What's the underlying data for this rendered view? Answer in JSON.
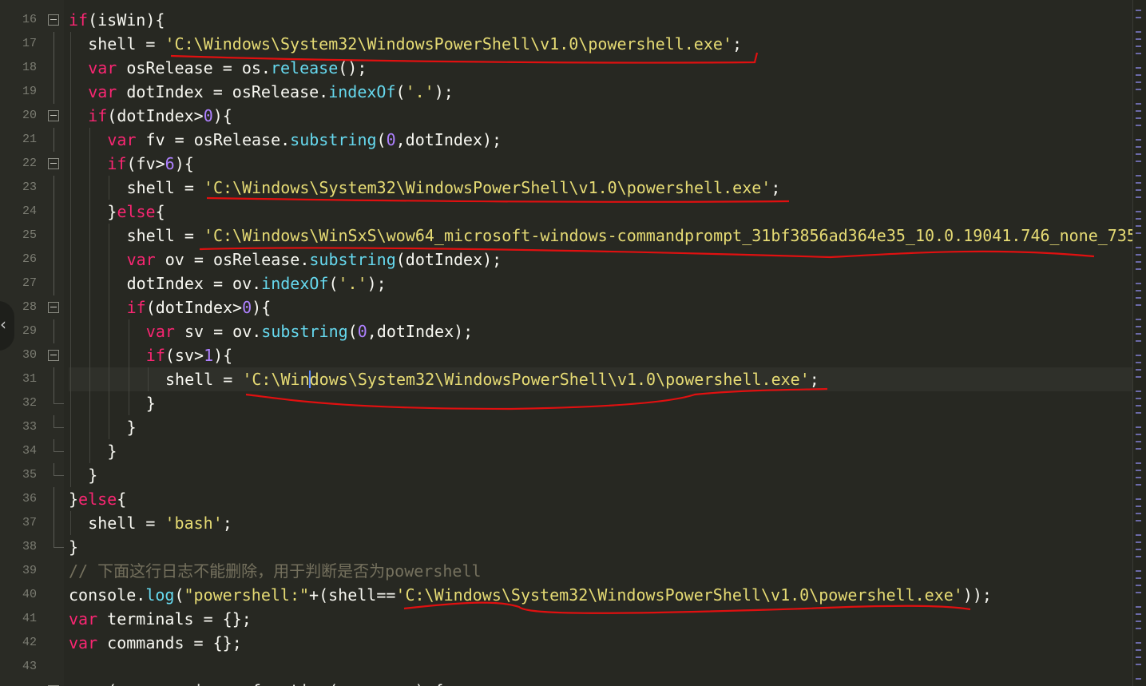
{
  "editor": {
    "lines": [
      {
        "num": "16",
        "indent": 0,
        "fold": "box",
        "tokens": [
          [
            "kw",
            "if"
          ],
          [
            "pl",
            "(isWin){"
          ]
        ]
      },
      {
        "num": "17",
        "indent": 1,
        "fold": "rail",
        "tokens": [
          [
            "pl",
            "shell = "
          ],
          [
            "str",
            "'C:\\Windows\\System32\\WindowsPowerShell\\v1.0\\powershell.exe'"
          ],
          [
            "pl",
            ";"
          ]
        ]
      },
      {
        "num": "18",
        "indent": 1,
        "fold": "rail",
        "tokens": [
          [
            "kw",
            "var"
          ],
          [
            "pl",
            " osRelease = os."
          ],
          [
            "fn",
            "release"
          ],
          [
            "pl",
            "();"
          ]
        ]
      },
      {
        "num": "19",
        "indent": 1,
        "fold": "rail",
        "tokens": [
          [
            "kw",
            "var"
          ],
          [
            "pl",
            " dotIndex = osRelease."
          ],
          [
            "fn",
            "indexOf"
          ],
          [
            "pl",
            "("
          ],
          [
            "str",
            "'.'"
          ],
          [
            "pl",
            ");"
          ]
        ]
      },
      {
        "num": "20",
        "indent": 1,
        "fold": "box",
        "tokens": [
          [
            "kw",
            "if"
          ],
          [
            "pl",
            "(dotIndex>"
          ],
          [
            "num",
            "0"
          ],
          [
            "pl",
            "){"
          ]
        ]
      },
      {
        "num": "21",
        "indent": 2,
        "fold": "rail",
        "tokens": [
          [
            "kw",
            "var"
          ],
          [
            "pl",
            " fv = osRelease."
          ],
          [
            "fn",
            "substring"
          ],
          [
            "pl",
            "("
          ],
          [
            "num",
            "0"
          ],
          [
            "pl",
            ",dotIndex);"
          ]
        ]
      },
      {
        "num": "22",
        "indent": 2,
        "fold": "box",
        "tokens": [
          [
            "kw",
            "if"
          ],
          [
            "pl",
            "(fv>"
          ],
          [
            "num",
            "6"
          ],
          [
            "pl",
            "){"
          ]
        ]
      },
      {
        "num": "23",
        "indent": 3,
        "fold": "rail",
        "tokens": [
          [
            "pl",
            "shell = "
          ],
          [
            "str",
            "'C:\\Windows\\System32\\WindowsPowerShell\\v1.0\\powershell.exe'"
          ],
          [
            "pl",
            ";"
          ]
        ]
      },
      {
        "num": "24",
        "indent": 2,
        "fold": "rail",
        "tokens": [
          [
            "pl",
            "}"
          ],
          [
            "kw",
            "else"
          ],
          [
            "pl",
            "{"
          ]
        ]
      },
      {
        "num": "25",
        "indent": 3,
        "fold": "rail",
        "tokens": [
          [
            "pl",
            "shell = "
          ],
          [
            "str",
            "'C:\\Windows\\WinSxS\\wow64_microsoft-windows-commandprompt_31bf3856ad364e35_10.0.19041.746_none_735"
          ]
        ]
      },
      {
        "num": "26",
        "indent": 3,
        "fold": "rail",
        "tokens": [
          [
            "kw",
            "var"
          ],
          [
            "pl",
            " ov = osRelease."
          ],
          [
            "fn",
            "substring"
          ],
          [
            "pl",
            "(dotIndex);"
          ]
        ]
      },
      {
        "num": "27",
        "indent": 3,
        "fold": "rail",
        "tokens": [
          [
            "pl",
            "dotIndex = ov."
          ],
          [
            "fn",
            "indexOf"
          ],
          [
            "pl",
            "("
          ],
          [
            "str",
            "'.'"
          ],
          [
            "pl",
            ");"
          ]
        ]
      },
      {
        "num": "28",
        "indent": 3,
        "fold": "box",
        "tokens": [
          [
            "kw",
            "if"
          ],
          [
            "pl",
            "(dotIndex>"
          ],
          [
            "num",
            "0"
          ],
          [
            "pl",
            "){"
          ]
        ]
      },
      {
        "num": "29",
        "indent": 4,
        "fold": "rail",
        "tokens": [
          [
            "kw",
            "var"
          ],
          [
            "pl",
            " sv = ov."
          ],
          [
            "fn",
            "substring"
          ],
          [
            "pl",
            "("
          ],
          [
            "num",
            "0"
          ],
          [
            "pl",
            ",dotIndex);"
          ]
        ]
      },
      {
        "num": "30",
        "indent": 4,
        "fold": "box",
        "tokens": [
          [
            "kw",
            "if"
          ],
          [
            "pl",
            "(sv>"
          ],
          [
            "num",
            "1"
          ],
          [
            "pl",
            "){"
          ]
        ]
      },
      {
        "num": "31",
        "indent": 5,
        "fold": "rail",
        "current": true,
        "tokens": [
          [
            "pl",
            "shell = "
          ],
          [
            "str",
            "'C:\\Win"
          ],
          [
            "cursor",
            ""
          ],
          [
            "str",
            "dows\\System32\\WindowsPowerShell\\v1.0\\powershell.exe'"
          ],
          [
            "pl",
            ";"
          ]
        ]
      },
      {
        "num": "32",
        "indent": 4,
        "fold": "end",
        "tokens": [
          [
            "pl",
            "}"
          ]
        ]
      },
      {
        "num": "33",
        "indent": 3,
        "fold": "end",
        "tokens": [
          [
            "pl",
            "}"
          ]
        ]
      },
      {
        "num": "34",
        "indent": 2,
        "fold": "end",
        "tokens": [
          [
            "pl",
            "}"
          ]
        ]
      },
      {
        "num": "35",
        "indent": 1,
        "fold": "end",
        "tokens": [
          [
            "pl",
            "}"
          ]
        ]
      },
      {
        "num": "36",
        "indent": 0,
        "fold": "rail",
        "tokens": [
          [
            "pl",
            "}"
          ],
          [
            "kw",
            "else"
          ],
          [
            "pl",
            "{"
          ]
        ]
      },
      {
        "num": "37",
        "indent": 1,
        "fold": "rail",
        "tokens": [
          [
            "pl",
            "shell = "
          ],
          [
            "str",
            "'bash'"
          ],
          [
            "pl",
            ";"
          ]
        ]
      },
      {
        "num": "38",
        "indent": 0,
        "fold": "end",
        "tokens": [
          [
            "pl",
            "}"
          ]
        ]
      },
      {
        "num": "39",
        "indent": 0,
        "fold": "none",
        "tokens": [
          [
            "cm",
            "// 下面这行日志不能删除，用于判断是否为powershell"
          ]
        ]
      },
      {
        "num": "40",
        "indent": 0,
        "fold": "none",
        "tokens": [
          [
            "pl",
            "console."
          ],
          [
            "fn",
            "log"
          ],
          [
            "pl",
            "("
          ],
          [
            "str",
            "\"powershell:\""
          ],
          [
            "pl",
            "+(shell=="
          ],
          [
            "str",
            "'C:\\Windows\\System32\\WindowsPowerShell\\v1.0\\powershell.exe'"
          ],
          [
            "pl",
            "));"
          ]
        ]
      },
      {
        "num": "41",
        "indent": 0,
        "fold": "none",
        "tokens": [
          [
            "kw",
            "var"
          ],
          [
            "pl",
            " terminals = {};"
          ]
        ]
      },
      {
        "num": "42",
        "indent": 0,
        "fold": "none",
        "tokens": [
          [
            "kw",
            "var"
          ],
          [
            "pl",
            " commands = {};"
          ]
        ]
      },
      {
        "num": "43",
        "indent": 0,
        "fold": "none",
        "tokens": []
      },
      {
        "num": "",
        "indent": 0,
        "fold": "box",
        "tokens": [
          [
            "pl",
            "    (        ion   function(        ) {"
          ]
        ]
      }
    ]
  },
  "colors": {
    "background": "#272822",
    "keyword": "#f92672",
    "function": "#66d9ef",
    "string": "#e6db74",
    "number": "#ae81ff",
    "comment": "#75715e",
    "annotation": "#e01010"
  },
  "overlay": {
    "handle_icon": "‹"
  }
}
